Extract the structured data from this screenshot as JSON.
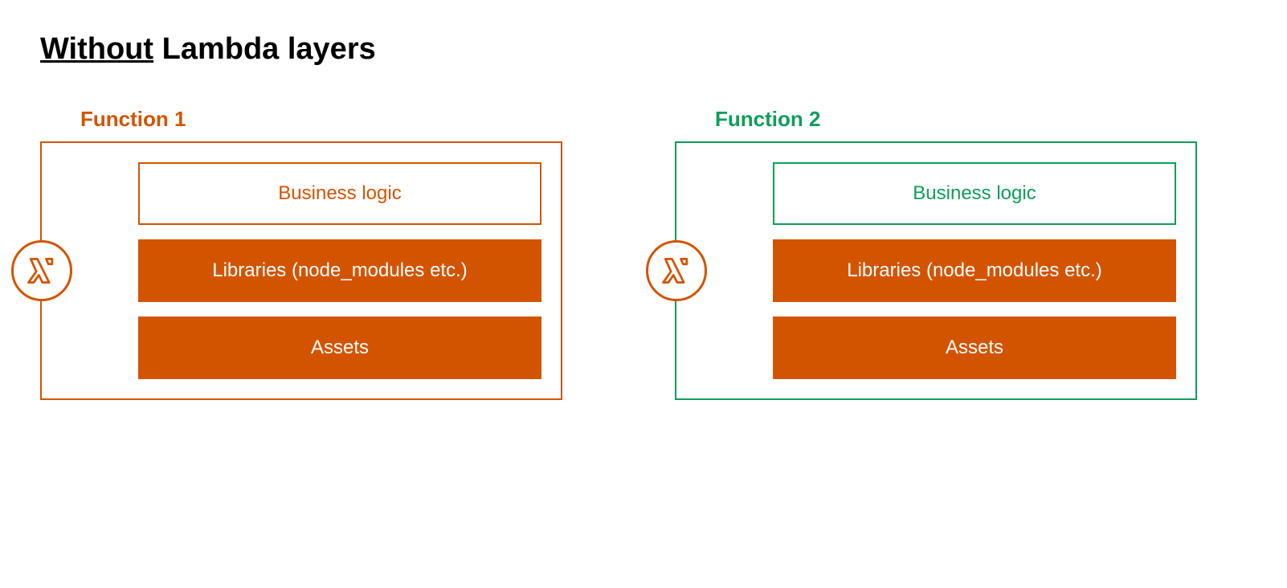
{
  "title": {
    "underlined": "Without",
    "rest": " Lambda layers"
  },
  "colors": {
    "orange": "#d35400",
    "green": "#0f9d58"
  },
  "functions": [
    {
      "label": "Function 1",
      "labelColor": "orange",
      "boxColor": "orange",
      "iconName": "lambda-icon",
      "layers": [
        {
          "text": "Business logic",
          "style": "outline",
          "color": "orange"
        },
        {
          "text": "Libraries (node_modules etc.)",
          "style": "solid",
          "color": "orange"
        },
        {
          "text": "Assets",
          "style": "solid",
          "color": "orange"
        }
      ]
    },
    {
      "label": "Function 2",
      "labelColor": "green",
      "boxColor": "green",
      "iconName": "lambda-icon",
      "layers": [
        {
          "text": "Business logic",
          "style": "outline",
          "color": "green"
        },
        {
          "text": "Libraries (node_modules etc.)",
          "style": "solid",
          "color": "orange"
        },
        {
          "text": "Assets",
          "style": "solid",
          "color": "orange"
        }
      ]
    }
  ]
}
